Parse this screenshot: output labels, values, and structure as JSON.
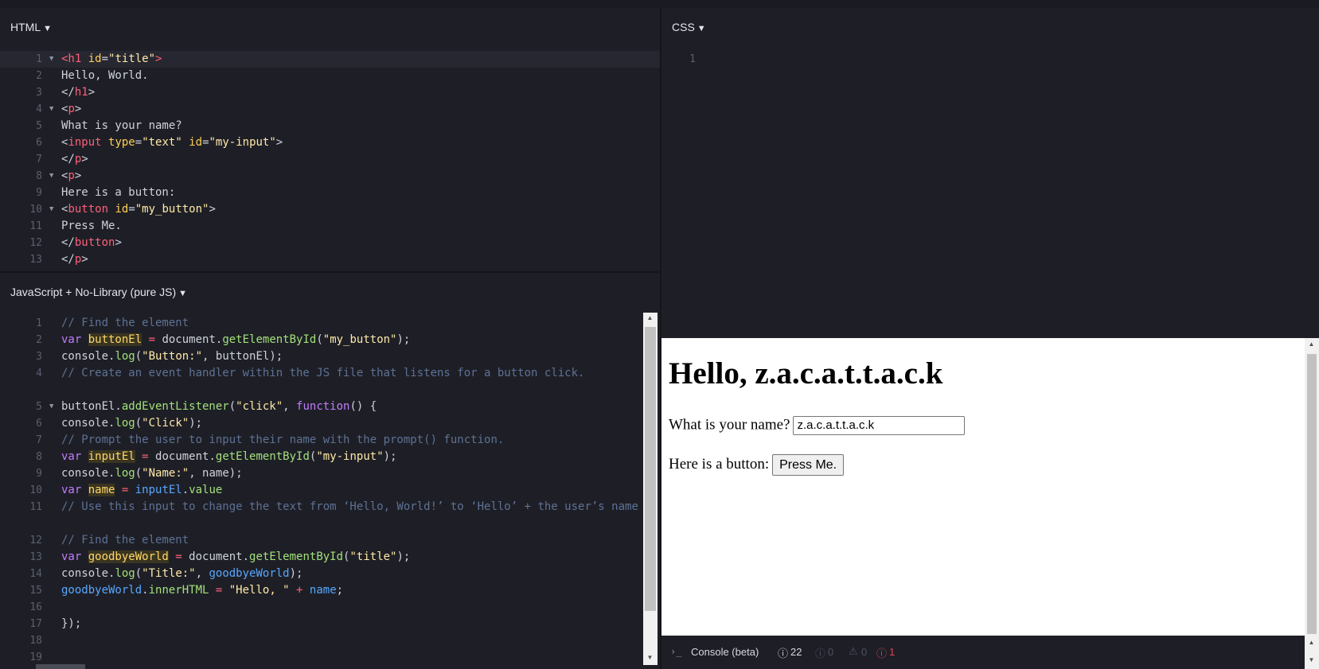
{
  "html_panel": {
    "title": "HTML",
    "lines": [
      {
        "n": "1",
        "fold": true,
        "active": true,
        "parts": [
          [
            "t-tag",
            "<h1"
          ],
          [
            "t-attr",
            " id"
          ],
          [
            "",
            "="
          ],
          [
            "t-str",
            "\"title\""
          ],
          [
            "t-tag",
            ">"
          ]
        ]
      },
      {
        "n": "2",
        "parts": [
          [
            "",
            "Hello, World."
          ]
        ]
      },
      {
        "n": "3",
        "parts": [
          [
            "",
            "</"
          ],
          [
            "t-tag",
            "h1"
          ],
          [
            "",
            ">"
          ]
        ]
      },
      {
        "n": "4",
        "fold": true,
        "parts": [
          [
            "",
            "<"
          ],
          [
            "t-tag",
            "p"
          ],
          [
            "",
            ">"
          ]
        ]
      },
      {
        "n": "5",
        "parts": [
          [
            "",
            "What is your name?"
          ]
        ]
      },
      {
        "n": "6",
        "parts": [
          [
            "",
            "<"
          ],
          [
            "t-tag",
            "input"
          ],
          [
            "t-attr",
            " type"
          ],
          [
            "",
            "="
          ],
          [
            "t-str",
            "\"text\""
          ],
          [
            "t-attr",
            " id"
          ],
          [
            "",
            "="
          ],
          [
            "t-str",
            "\"my-input\""
          ],
          [
            "",
            ">"
          ]
        ]
      },
      {
        "n": "7",
        "parts": [
          [
            "",
            "</"
          ],
          [
            "t-tag",
            "p"
          ],
          [
            "",
            ">"
          ]
        ]
      },
      {
        "n": "8",
        "fold": true,
        "parts": [
          [
            "",
            "<"
          ],
          [
            "t-tag",
            "p"
          ],
          [
            "",
            ">"
          ]
        ]
      },
      {
        "n": "9",
        "parts": [
          [
            "",
            "Here is a button:"
          ]
        ]
      },
      {
        "n": "10",
        "fold": true,
        "parts": [
          [
            "",
            "<"
          ],
          [
            "t-tag",
            "button"
          ],
          [
            "t-attr",
            " id"
          ],
          [
            "",
            "="
          ],
          [
            "t-str",
            "\"my_button\""
          ],
          [
            "",
            ">"
          ]
        ]
      },
      {
        "n": "11",
        "parts": [
          [
            "",
            "Press Me."
          ]
        ]
      },
      {
        "n": "12",
        "parts": [
          [
            "",
            "</"
          ],
          [
            "t-tag",
            "button"
          ],
          [
            "",
            ">"
          ]
        ]
      },
      {
        "n": "13",
        "parts": [
          [
            "",
            "</"
          ],
          [
            "t-tag",
            "p"
          ],
          [
            "",
            ">"
          ]
        ]
      }
    ]
  },
  "css_panel": {
    "title": "CSS",
    "lines": [
      {
        "n": "1",
        "parts": []
      }
    ]
  },
  "js_panel": {
    "title": "JavaScript + No-Library (pure JS)",
    "lines": [
      {
        "n": "1",
        "parts": [
          [
            "t-com",
            "// Find the element"
          ]
        ]
      },
      {
        "n": "2",
        "parts": [
          [
            "t-kw",
            "var "
          ],
          [
            "t-var",
            "buttonEl"
          ],
          [
            "t-op",
            " = "
          ],
          [
            "",
            "document."
          ],
          [
            "t-fn",
            "getElementById"
          ],
          [
            "",
            "("
          ],
          [
            "t-str",
            "\"my_button\""
          ],
          [
            "",
            ");"
          ]
        ]
      },
      {
        "n": "3",
        "parts": [
          [
            "",
            "console."
          ],
          [
            "t-fn",
            "log"
          ],
          [
            "",
            "("
          ],
          [
            "t-str",
            "\"Button:\""
          ],
          [
            "",
            ", buttonEl);"
          ]
        ]
      },
      {
        "n": "4",
        "wrap": true,
        "parts": [
          [
            "t-com",
            "// Create an event handler within the JS file that listens for a button click."
          ]
        ]
      },
      {
        "n": "5",
        "fold": true,
        "parts": [
          [
            "",
            "buttonEl."
          ],
          [
            "t-fn",
            "addEventListener"
          ],
          [
            "",
            "("
          ],
          [
            "t-str",
            "\"click\""
          ],
          [
            "",
            ", "
          ],
          [
            "t-kw",
            "function"
          ],
          [
            "",
            "() {"
          ]
        ]
      },
      {
        "n": "6",
        "parts": [
          [
            "",
            "console."
          ],
          [
            "t-fn",
            "log"
          ],
          [
            "",
            "("
          ],
          [
            "t-str",
            "\"Click\""
          ],
          [
            "",
            ");"
          ]
        ]
      },
      {
        "n": "7",
        "parts": [
          [
            "t-com",
            "// Prompt the user to input their name with the prompt() function."
          ]
        ]
      },
      {
        "n": "8",
        "parts": [
          [
            "t-kw",
            "var "
          ],
          [
            "t-var",
            "inputEl"
          ],
          [
            "t-op",
            " = "
          ],
          [
            "",
            "document."
          ],
          [
            "t-fn",
            "getElementById"
          ],
          [
            "",
            "("
          ],
          [
            "t-str",
            "\"my-input\""
          ],
          [
            "",
            ");"
          ]
        ]
      },
      {
        "n": "9",
        "parts": [
          [
            "",
            "console."
          ],
          [
            "t-fn",
            "log"
          ],
          [
            "",
            "("
          ],
          [
            "t-str",
            "\"Name:\""
          ],
          [
            "",
            ", name);"
          ]
        ]
      },
      {
        "n": "10",
        "parts": [
          [
            "t-kw",
            "var "
          ],
          [
            "t-var",
            "name"
          ],
          [
            "t-op",
            " = "
          ],
          [
            "t-blue",
            "inputEl"
          ],
          [
            "",
            "."
          ],
          [
            "t-fn",
            "value"
          ]
        ]
      },
      {
        "n": "11",
        "wrap": true,
        "parts": [
          [
            "t-com",
            "// Use this input to change the text from ‘Hello, World!’ to ‘Hello’ + the user’s name"
          ]
        ]
      },
      {
        "n": "12",
        "parts": [
          [
            "t-com",
            "// Find the element"
          ]
        ]
      },
      {
        "n": "13",
        "parts": [
          [
            "t-kw",
            "var "
          ],
          [
            "t-var",
            "goodbyeWorld"
          ],
          [
            "t-op",
            " = "
          ],
          [
            "",
            "document."
          ],
          [
            "t-fn",
            "getElementById"
          ],
          [
            "",
            "("
          ],
          [
            "t-str",
            "\"title\""
          ],
          [
            "",
            ");"
          ]
        ]
      },
      {
        "n": "14",
        "parts": [
          [
            "",
            "console."
          ],
          [
            "t-fn",
            "log"
          ],
          [
            "",
            "("
          ],
          [
            "t-str",
            "\"Title:\""
          ],
          [
            "",
            ", "
          ],
          [
            "t-blue",
            "goodbyeWorld"
          ],
          [
            "",
            ");"
          ]
        ]
      },
      {
        "n": "15",
        "parts": [
          [
            "t-blue",
            "goodbyeWorld"
          ],
          [
            "",
            "."
          ],
          [
            "t-fn",
            "innerHTML"
          ],
          [
            "t-op",
            " = "
          ],
          [
            "t-str",
            "\"Hello, \""
          ],
          [
            "t-op",
            " + "
          ],
          [
            "t-blue",
            "name"
          ],
          [
            "",
            ";"
          ]
        ]
      },
      {
        "n": "16",
        "parts": []
      },
      {
        "n": "17",
        "parts": [
          [
            "",
            "});"
          ]
        ]
      },
      {
        "n": "18",
        "parts": []
      },
      {
        "n": "19",
        "parts": []
      }
    ]
  },
  "result": {
    "heading": "Hello, z.a.c.a.t.t.a.c.k",
    "name_prompt": "What is your name?",
    "input_value": "z.a.c.a.t.t.a.c.k",
    "button_prompt": "Here is a button:",
    "button_label": "Press Me."
  },
  "console": {
    "label": "Console (beta)",
    "info_count": "22",
    "log_count": "0",
    "warn_count": "0",
    "error_count": "1",
    "prompt_glyph": "›_",
    "error_color": "#e0405a"
  }
}
